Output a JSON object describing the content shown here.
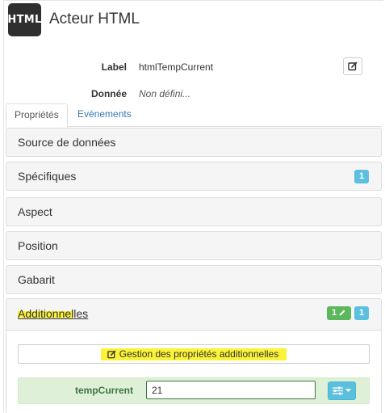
{
  "header": {
    "logo_text": "HTML",
    "title": "Acteur HTML"
  },
  "info": {
    "label_key": "Label",
    "label_value": "htmlTempCurrent",
    "data_key": "Donnée",
    "data_value": "Non défini..."
  },
  "tabs": [
    {
      "label": "Propriétés",
      "active": true
    },
    {
      "label": "Evénements",
      "active": false
    }
  ],
  "panels": [
    {
      "label": "Source de données"
    },
    {
      "label": "Spécifiques",
      "badge": "1"
    },
    {
      "label": "Aspect"
    },
    {
      "label": "Position"
    },
    {
      "label": "Gabarit"
    }
  ],
  "additional": {
    "title_highlighted": "Additionnel",
    "title_rest": "les",
    "badge_green": "1",
    "badge_blue": "1",
    "manage_button": "Gestion des propriétés additionnelles",
    "property": {
      "name": "tempCurrent",
      "value": "21"
    }
  },
  "colors": {
    "info": "#5bc0de",
    "success": "#5cb85c",
    "highlight": "#fbf337",
    "link": "#337ab7"
  },
  "icons": {
    "edit": "edit-square-icon",
    "pencil": "pencil-icon",
    "sliders": "sliders-icon",
    "caret": "caret-down-icon"
  }
}
